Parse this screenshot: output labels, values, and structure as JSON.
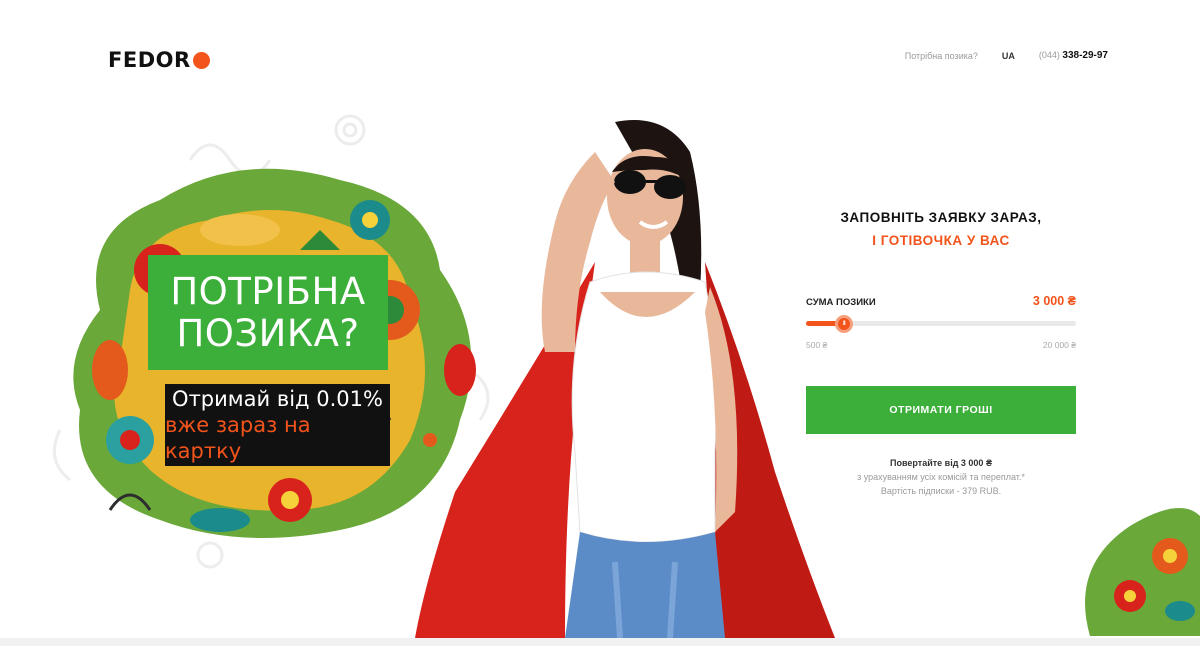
{
  "header": {
    "logo_text": "FEDOR",
    "nav_question": "Потрібна позика?",
    "lang": "UA",
    "phone_code": "(044)",
    "phone_number": "338-29-97"
  },
  "promo": {
    "title_line1": "ПОТРІБНА",
    "title_line2": "ПОЗИКА?",
    "sub_line1": "Отримай від 0.01%",
    "sub_line2": "вже зараз на картку"
  },
  "form": {
    "heading_line1": "ЗАПОВНІТЬ ЗАЯВКУ ЗАРАЗ,",
    "heading_line2": "І ГОТІВОЧКА У ВАС",
    "amount_label": "СУМА ПОЗИКИ",
    "amount_value": "3 000 ₴",
    "slider": {
      "min": 500,
      "max": 20000,
      "value": 3000,
      "thumb_glyph": "III"
    },
    "range_min_label": "500 ₴",
    "range_max_label": "20 000 ₴",
    "cta_label": "ОТРИМАТИ ГРОШІ",
    "repay_line1": "Повертайте від 3 000 ₴",
    "repay_line2": "з урахуванням усіх комісій та переплат.*",
    "repay_line3": "Вартість підписки - 379 RUB."
  },
  "colors": {
    "accent": "#f2541b",
    "green": "#3cae3a",
    "cape_red": "#d8231c",
    "text_dark": "#111111",
    "muted": "#9a9a9a"
  },
  "icons": {
    "logo_mark": "orange-dot-icon",
    "slider_thumb": "slider-grip-icon"
  }
}
